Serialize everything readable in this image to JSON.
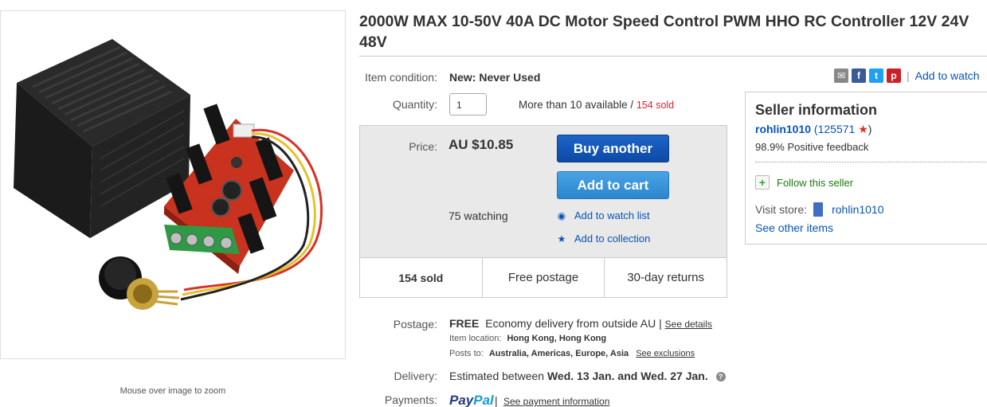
{
  "listing": {
    "title": "2000W MAX 10-50V 40A DC Motor Speed Control PWM HHO RC Controller 12V 24V 48V",
    "zoom_hint": "Mouse over image to zoom"
  },
  "share": {
    "icons": [
      "email-icon",
      "facebook-icon",
      "twitter-icon",
      "pinterest-icon"
    ],
    "separator": "|",
    "add_to_watch": "Add to watch"
  },
  "condition": {
    "label": "Item condition:",
    "value": "New: Never Used"
  },
  "quantity": {
    "label": "Quantity:",
    "value": "1",
    "available": "More than 10 available /",
    "sold": "154 sold"
  },
  "price": {
    "label": "Price:",
    "value": "AU $10.85",
    "watching": "75 watching",
    "buy_label": "Buy another",
    "cart_label": "Add to cart",
    "watch_link": "Add to watch list",
    "collection_link": "Add to collection",
    "stats": [
      "154 sold",
      "Free postage",
      "30-day returns"
    ]
  },
  "seller": {
    "title": "Seller information",
    "name": "rohlin1010",
    "score_open": "(",
    "score": "125571",
    "score_close": ")",
    "feedback": "98.9% Positive feedback",
    "follow": "Follow this seller",
    "visit_label": "Visit store:",
    "store_name": "rohlin1010",
    "other_items": "See other items"
  },
  "postage": {
    "label": "Postage:",
    "free": "FREE",
    "desc": "Economy delivery from outside AU",
    "sep": "|",
    "details_link": "See details",
    "location_label": "Item location:",
    "location": "Hong Kong, Hong Kong",
    "posts_label": "Posts to:",
    "posts_to": "Australia, Americas, Europe, Asia",
    "exclusions_link": "See exclusions"
  },
  "delivery": {
    "label": "Delivery:",
    "prefix": "Estimated between",
    "range": "Wed. 13 Jan. and Wed. 27 Jan."
  },
  "payments": {
    "label": "Payments:",
    "paypal_pay": "Pay",
    "paypal_pal": "Pal",
    "sep": "|",
    "info_link": "See payment information"
  },
  "colors": {
    "link": "#0654ba",
    "sold_red": "#dd1e31",
    "buy_button": "#0d4aa6",
    "cart_button": "#2b86cf",
    "paypal_dark": "#253b80",
    "paypal_light": "#179bd7"
  }
}
